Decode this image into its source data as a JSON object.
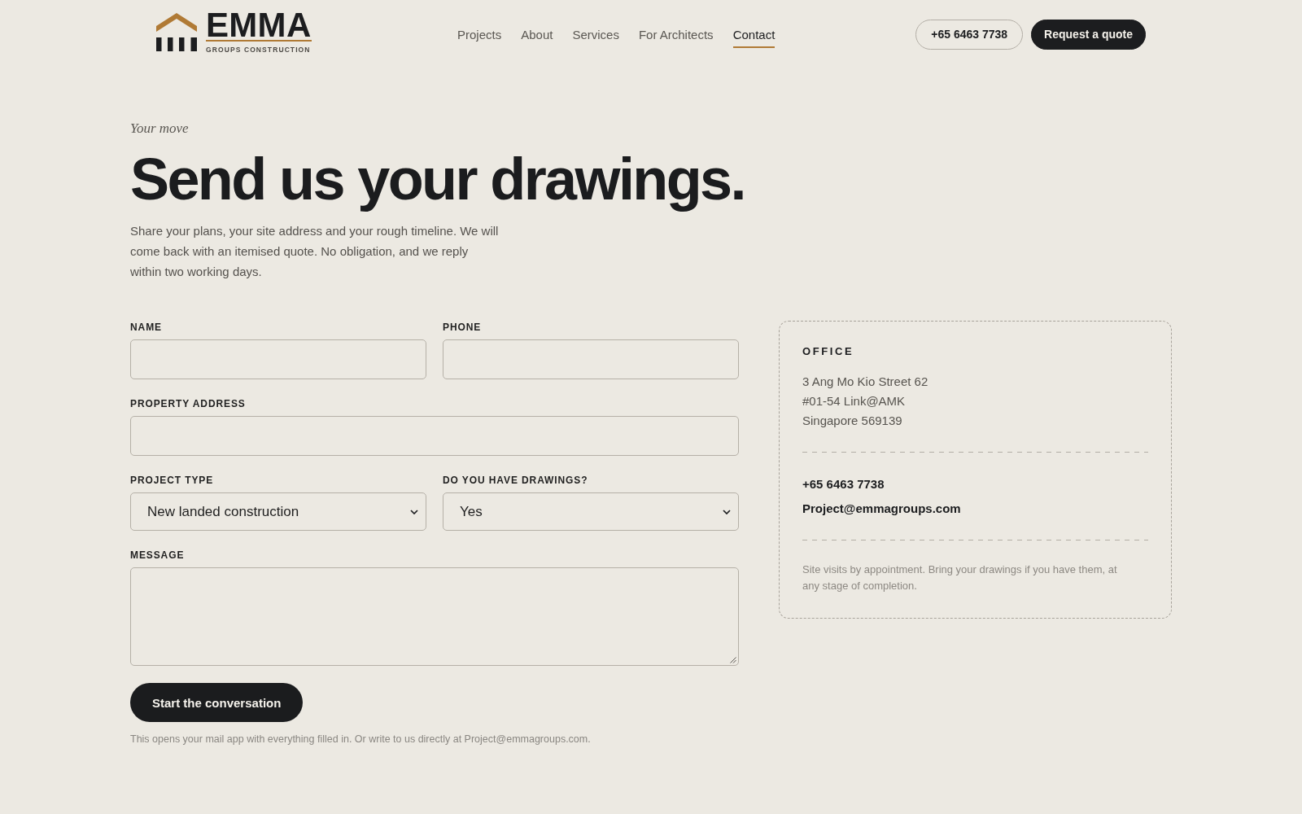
{
  "header": {
    "logo": {
      "wordmark": "EMMA",
      "tagline": "GROUPS CONSTRUCTION"
    },
    "nav": [
      {
        "label": "Projects",
        "selected": false
      },
      {
        "label": "About",
        "selected": false
      },
      {
        "label": "Services",
        "selected": false
      },
      {
        "label": "For Architects",
        "selected": false
      },
      {
        "label": "Contact",
        "selected": true
      }
    ],
    "actions": [
      {
        "kind": "outline",
        "label": "+65 6463 7738"
      },
      {
        "kind": "solid",
        "label": "Request a quote"
      }
    ]
  },
  "hero": {
    "eyebrow": "Your move",
    "title": "Send us your drawings.",
    "intro": "Share your plans, your site address and your rough timeline. We will come back with an itemised quote. No obligation, and we reply within two working days."
  },
  "form": {
    "rows": [
      {
        "fields": [
          {
            "kind": "text",
            "label": "NAME"
          },
          {
            "kind": "text",
            "label": "PHONE"
          }
        ]
      },
      {
        "fields": [
          {
            "kind": "text",
            "label": "PROPERTY ADDRESS"
          }
        ]
      },
      {
        "fields": [
          {
            "kind": "select",
            "label": "PROJECT TYPE",
            "value": "New landed construction"
          },
          {
            "kind": "select",
            "label": "DO YOU HAVE DRAWINGS?",
            "value": "Yes"
          }
        ]
      },
      {
        "fields": [
          {
            "kind": "textarea",
            "label": "MESSAGE"
          }
        ]
      }
    ],
    "submit": "Start the conversation",
    "note": "This opens your mail app with everything filled in. Or write to us directly at Project@emmagroups.com."
  },
  "office": {
    "title": "OFFICE",
    "address": [
      "3 Ang Mo Kio Street 62",
      "#01-54 Link@AMK",
      "Singapore 569139"
    ],
    "phone": "+65 6463 7738",
    "email": "Project@emmagroups.com",
    "note": "Site visits by appointment. Bring your drawings if you have them, at any stage of completion."
  }
}
